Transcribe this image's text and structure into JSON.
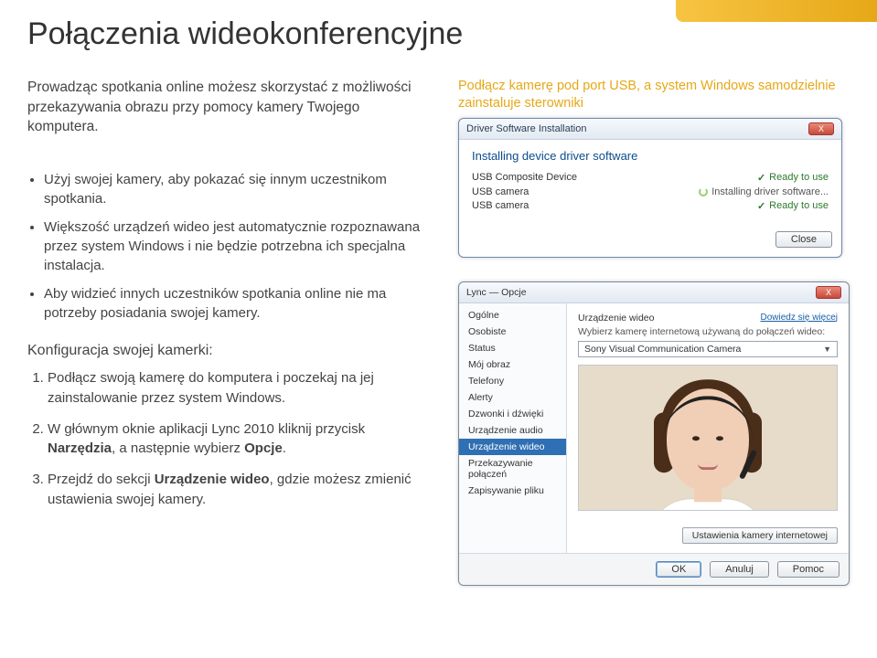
{
  "title": "Połączenia wideokonferencyjne",
  "intro": "Prowadząc spotkania online możesz skorzystać z możliwości przekazywania obrazu przy pomocy kamery Twojego komputera.",
  "bullets": [
    "Użyj swojej kamery, aby pokazać się innym uczestnikom spotkania.",
    "Większość urządzeń wideo jest automatycznie rozpoznawana przez system Windows i nie będzie potrzebna ich specjalna instalacja.",
    "Aby widzieć innych uczestników spotkania online nie ma potrzeby posiadania swojej kamery."
  ],
  "config_head": "Konfiguracja swojej kamerki:",
  "steps": [
    {
      "text": "Podłącz swoją kamerę do komputera i poczekaj na jej zainstalowanie przez system Windows."
    },
    {
      "prefix": "W głównym oknie aplikacji Lync 2010 kliknij przycisk ",
      "b1": "Narzędzia",
      "mid": ", a następnie wybierz ",
      "b2": "Opcje",
      "suffix": "."
    },
    {
      "prefix": "Przejdź do sekcji ",
      "b1": "Urządzenie wideo",
      "suffix": ", gdzie możesz zmienić ustawienia swojej kamery."
    }
  ],
  "note": "Podłącz kamerę pod port USB, a system Windows samodzielnie zainstaluje sterowniki",
  "driver": {
    "title": "Driver Software Installation",
    "header": "Installing device driver software",
    "devices": [
      {
        "name": "USB Composite Device",
        "status": "Ready to use",
        "state": "ok"
      },
      {
        "name": "USB camera",
        "status": "Installing driver software...",
        "state": "inst"
      },
      {
        "name": "USB camera",
        "status": "Ready to use",
        "state": "ok"
      }
    ],
    "close": "Close"
  },
  "options": {
    "title": "Lync — Opcje",
    "nav": [
      "Ogólne",
      "Osobiste",
      "Status",
      "Mój obraz",
      "Telefony",
      "Alerty",
      "Dzwonki i dźwięki",
      "Urządzenie audio",
      "Urządzenie wideo",
      "Przekazywanie połączeń",
      "Zapisywanie pliku"
    ],
    "selected_index": 8,
    "section_label": "Urządzenie wideo",
    "sub_label": "Wybierz kamerę internetową używaną do połączeń wideo:",
    "more": "Dowiedz się więcej",
    "dropdown": "Sony Visual Communication Camera",
    "settings_btn": "Ustawienia kamery internetowej",
    "ok": "OK",
    "cancel": "Anuluj",
    "help": "Pomoc"
  }
}
